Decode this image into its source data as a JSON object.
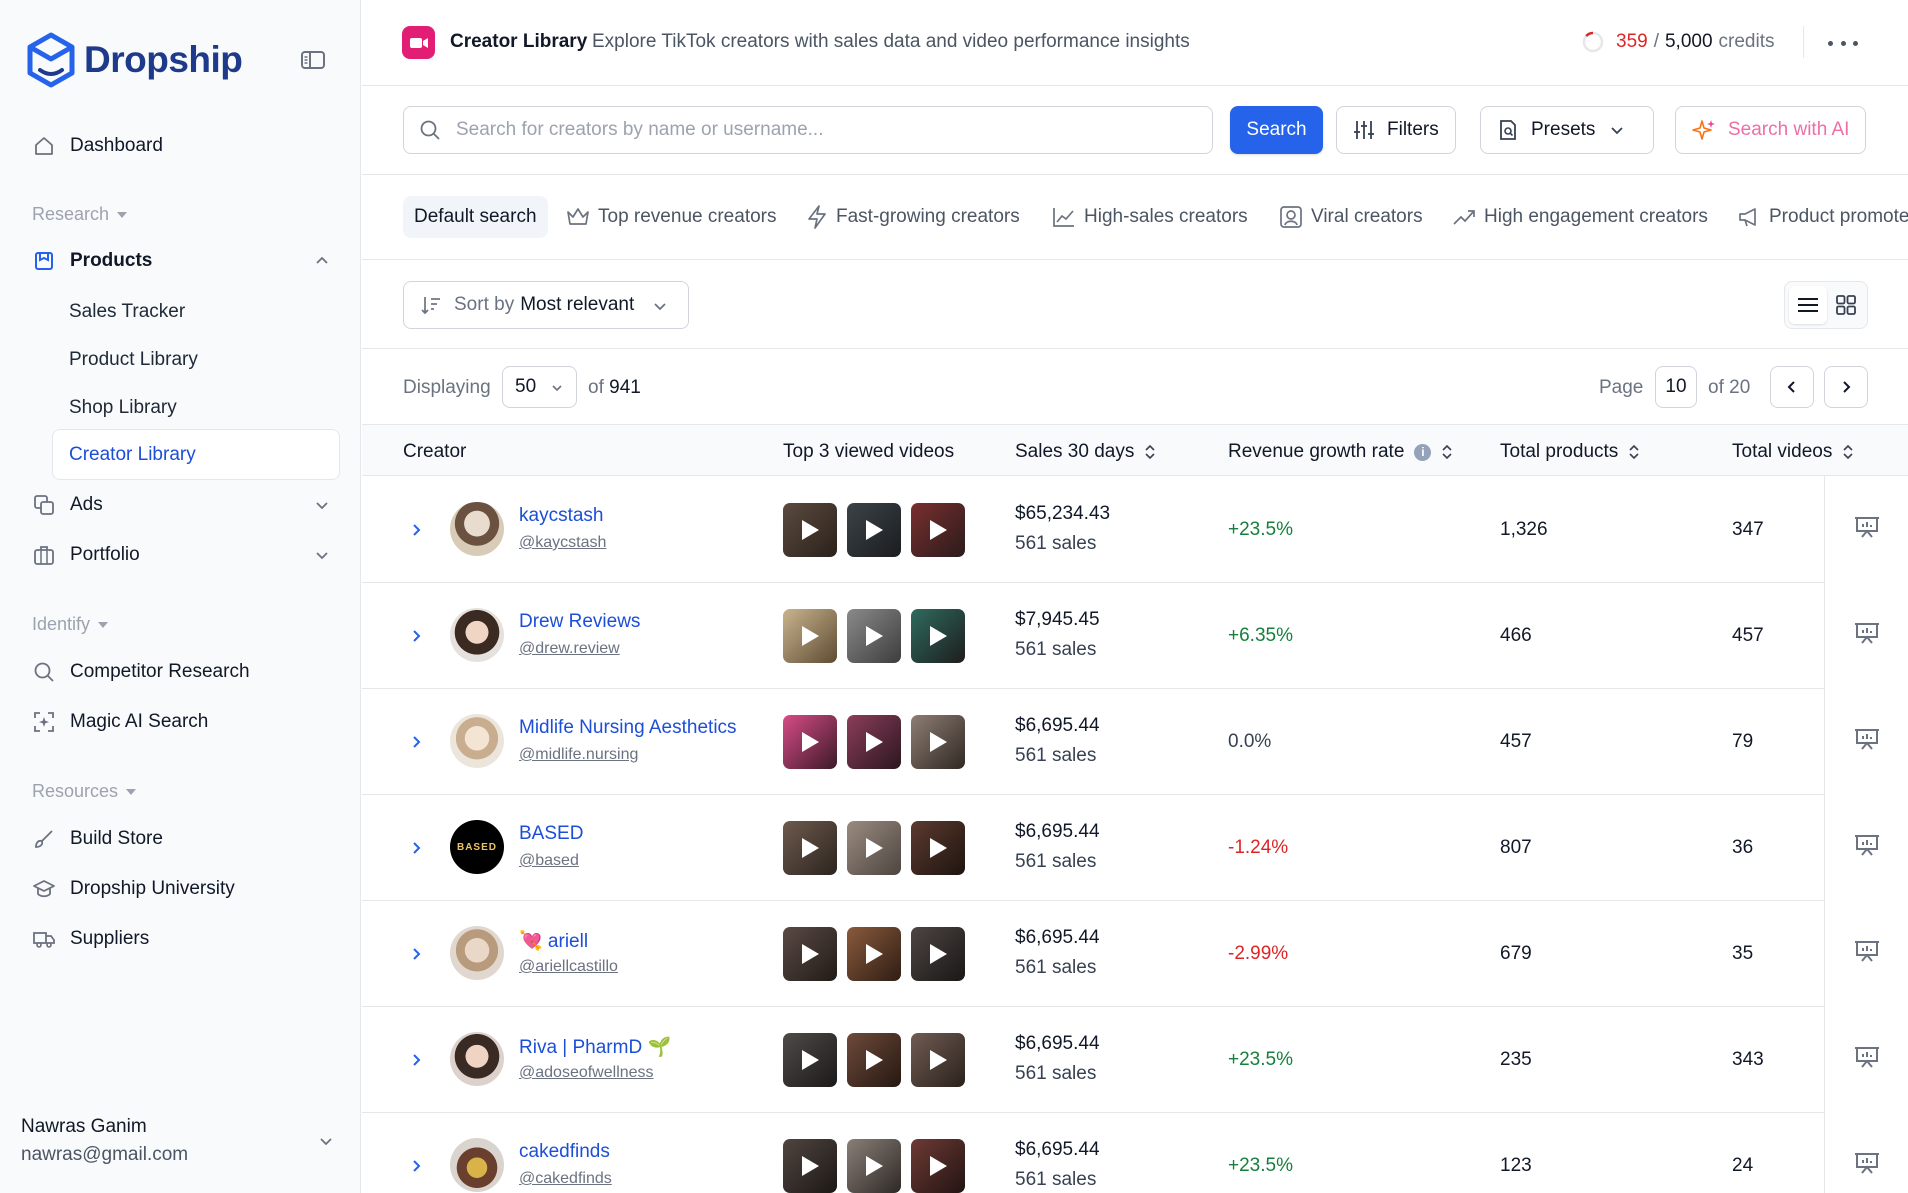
{
  "brand": {
    "name": "Dropship"
  },
  "sidebar": {
    "dashboard": "Dashboard",
    "sections": {
      "research": "Research",
      "identify": "Identify",
      "resources": "Resources"
    },
    "products": "Products",
    "sub_items": [
      "Sales Tracker",
      "Product Library",
      "Shop Library",
      "Creator Library"
    ],
    "ads": "Ads",
    "portfolio": "Portfolio",
    "competitor": "Competitor Research",
    "magic": "Magic AI Search",
    "build_store": "Build Store",
    "university": "Dropship University",
    "suppliers": "Suppliers",
    "user": {
      "name": "Nawras Ganim",
      "email": "nawras@gmail.com"
    }
  },
  "header": {
    "title": "Creator Library",
    "subtitle": "Explore TikTok creators with sales data and video performance insights",
    "credits_used": "359",
    "credits_sep": "/",
    "credits_total": "5,000",
    "credits_label": "credits"
  },
  "search": {
    "placeholder": "Search for creators by name or username...",
    "value": "",
    "search_button": "Search",
    "filters_button": "Filters",
    "presets_button": "Presets",
    "ai_button": "Search with AI"
  },
  "presets": [
    "Default search",
    "Top revenue creators",
    "Fast-growing creators",
    "High-sales creators",
    "Viral creators",
    "High engagement creators",
    "Product promote"
  ],
  "sort": {
    "prefix": "Sort by",
    "value": "Most relevant"
  },
  "pagination": {
    "displaying_label": "Displaying",
    "per_page": "50",
    "of_label": "of",
    "total": "941",
    "page_label": "Page",
    "page": "10",
    "of_pages": "of 20"
  },
  "table": {
    "columns": [
      "Creator",
      "Top 3 viewed videos",
      "Sales 30 days",
      "Revenue growth rate",
      "Total products",
      "Total videos"
    ],
    "rows": [
      {
        "name": "kaycstash",
        "handle": "@kaycstash",
        "sales_amount": "$65,234.43",
        "sales_count": "561 sales",
        "growth": "+23.5%",
        "growth_type": "pos",
        "products": "1,326",
        "videos": "347"
      },
      {
        "name": "Drew Reviews",
        "handle": "@drew.review",
        "sales_amount": "$7,945.45",
        "sales_count": "561 sales",
        "growth": "+6.35%",
        "growth_type": "pos",
        "products": "466",
        "videos": "457"
      },
      {
        "name": "Midlife Nursing Aesthetics",
        "handle": "@midlife.nursing",
        "sales_amount": "$6,695.44",
        "sales_count": "561 sales",
        "growth": "0.0%",
        "growth_type": "zero",
        "products": "457",
        "videos": "79"
      },
      {
        "name": "BASED",
        "handle": "@based",
        "sales_amount": "$6,695.44",
        "sales_count": "561 sales",
        "growth": "-1.24%",
        "growth_type": "neg",
        "products": "807",
        "videos": "36"
      },
      {
        "name": "💘 ariell",
        "handle": "@ariellcastillo",
        "sales_amount": "$6,695.44",
        "sales_count": "561 sales",
        "growth": "-2.99%",
        "growth_type": "neg",
        "products": "679",
        "videos": "35"
      },
      {
        "name": "Riva | PharmD 🌱",
        "handle": "@adoseofwellness",
        "sales_amount": "$6,695.44",
        "sales_count": "561 sales",
        "growth": "+23.5%",
        "growth_type": "pos",
        "products": "235",
        "videos": "343"
      },
      {
        "name": "cakedfinds",
        "handle": "@cakedfinds",
        "sales_amount": "$6,695.44",
        "sales_count": "561 sales",
        "growth": "+23.5%",
        "growth_type": "pos",
        "products": "123",
        "videos": "24"
      }
    ]
  },
  "avatar_logo_text": "BASED",
  "colors": {
    "accent": "#2563eb",
    "link": "#1d4ed8",
    "positive": "#15803d",
    "negative": "#dc2626",
    "brand": "#1f3a8a",
    "app_icon": "#e11d74"
  }
}
